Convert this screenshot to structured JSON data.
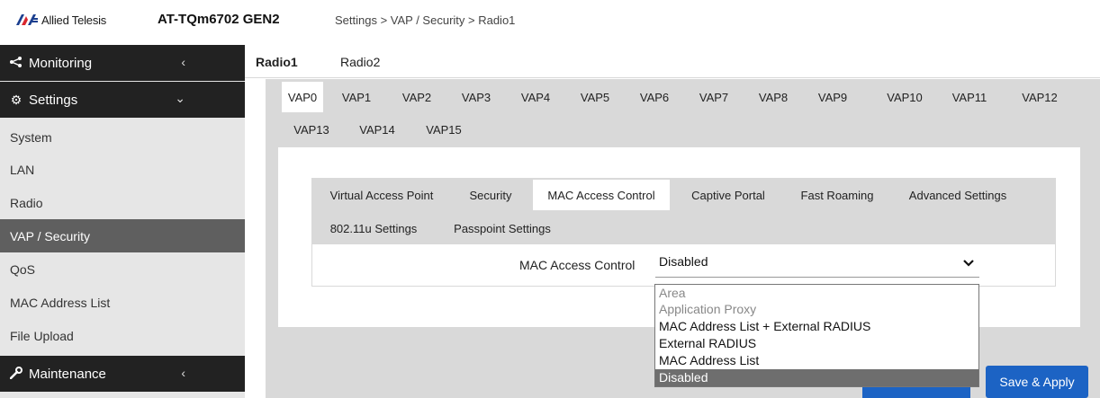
{
  "header": {
    "brand": "Allied Telesis",
    "device_name": "AT-TQm6702 GEN2",
    "breadcrumb": "Settings > VAP / Security > Radio1"
  },
  "sidebar": {
    "monitoring": "Monitoring",
    "settings": "Settings",
    "items": [
      "System",
      "LAN",
      "Radio",
      "VAP / Security",
      "QoS",
      "MAC Address List",
      "File Upload"
    ],
    "active_item": "VAP / Security",
    "maintenance": "Maintenance"
  },
  "radio_tabs": [
    "Radio1",
    "Radio2"
  ],
  "vap_tabs": [
    "VAP0",
    "VAP1",
    "VAP2",
    "VAP3",
    "VAP4",
    "VAP5",
    "VAP6",
    "VAP7",
    "VAP8",
    "VAP9",
    "VAP10",
    "VAP11",
    "VAP12",
    "VAP13",
    "VAP14",
    "VAP15"
  ],
  "sub_tabs": [
    "Virtual Access Point",
    "Security",
    "MAC Access Control",
    "Captive Portal",
    "Fast Roaming",
    "Advanced Settings",
    "802.11u Settings",
    "Passpoint Settings"
  ],
  "form": {
    "mac_access_label": "MAC Access Control",
    "mac_access_value": "Disabled"
  },
  "dropdown_options": [
    "Area",
    "Application Proxy",
    "MAC Address List + External RADIUS",
    "External RADIUS",
    "MAC Address List",
    "Disabled"
  ],
  "buttons": {
    "save_apply": "Save & Apply"
  },
  "colors": {
    "sidebar_dark": "#222222",
    "sidebar_active": "#5f5f5f",
    "panel_gray": "#d9d9d9",
    "button_blue": "#1c63c4",
    "brand_red": "#d9262e",
    "brand_blue": "#1b3f8f"
  }
}
